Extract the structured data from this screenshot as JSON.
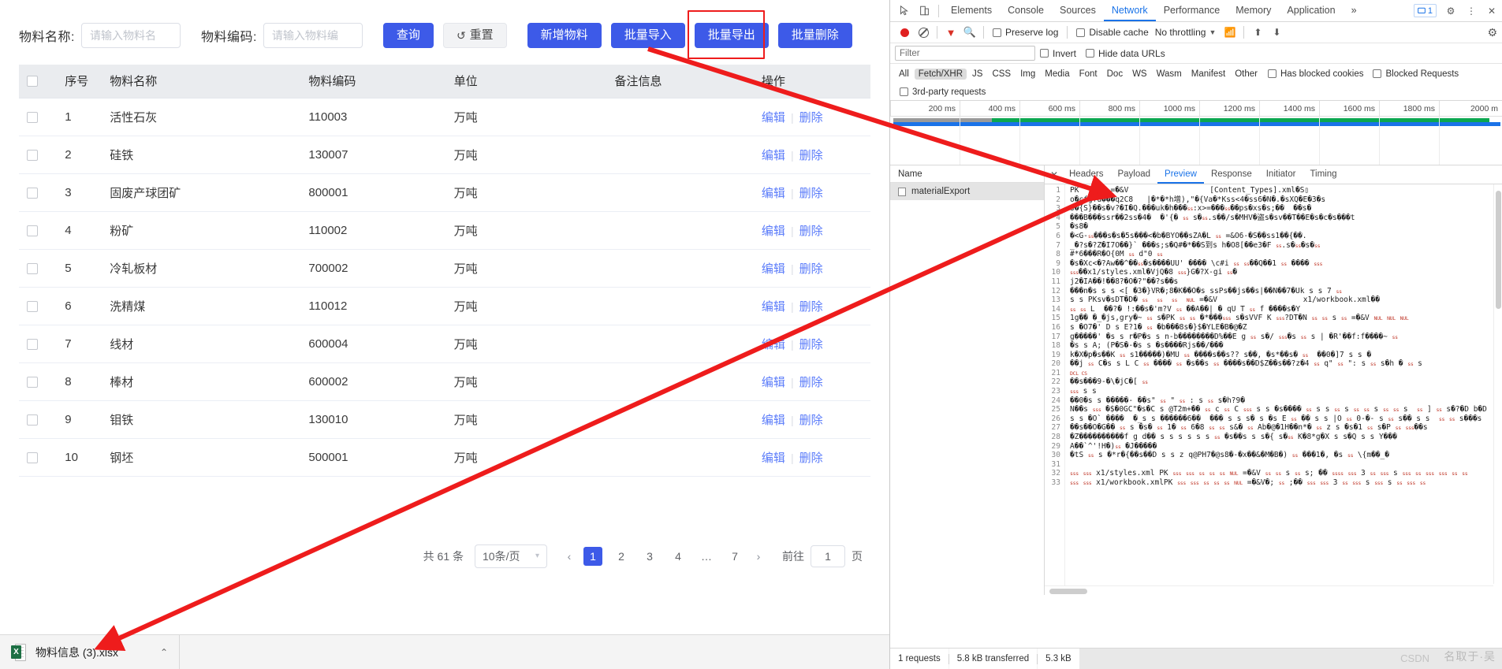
{
  "app": {
    "filters": [
      {
        "label": "物料名称:",
        "placeholder": "请输入物料名",
        "value": ""
      },
      {
        "label": "物料编码:",
        "placeholder": "请输入物料编",
        "value": ""
      }
    ],
    "buttons": {
      "query": "查询",
      "reset": "重置",
      "add": "新增物料",
      "import": "批量导入",
      "export": "批量导出",
      "delete": "批量删除"
    },
    "highlight_color": "#ee1c1c",
    "accent_color": "#3d5ae8",
    "table": {
      "columns": [
        "",
        "序号",
        "物料名称",
        "物料编码",
        "单位",
        "备注信息",
        "操作"
      ],
      "rows": [
        {
          "idx": "1",
          "name": "活性石灰",
          "code": "110003",
          "unit": "万吨",
          "memo": "",
          "edit": "编辑",
          "del": "删除"
        },
        {
          "idx": "2",
          "name": "硅铁",
          "code": "130007",
          "unit": "万吨",
          "memo": "",
          "edit": "编辑",
          "del": "删除"
        },
        {
          "idx": "3",
          "name": "固废产球团矿",
          "code": "800001",
          "unit": "万吨",
          "memo": "",
          "edit": "编辑",
          "del": "删除"
        },
        {
          "idx": "4",
          "name": "粉矿",
          "code": "110002",
          "unit": "万吨",
          "memo": "",
          "edit": "编辑",
          "del": "删除"
        },
        {
          "idx": "5",
          "name": "冷轧板材",
          "code": "700002",
          "unit": "万吨",
          "memo": "",
          "edit": "编辑",
          "del": "删除"
        },
        {
          "idx": "6",
          "name": "洗精煤",
          "code": "110012",
          "unit": "万吨",
          "memo": "",
          "edit": "编辑",
          "del": "删除"
        },
        {
          "idx": "7",
          "name": "线材",
          "code": "600004",
          "unit": "万吨",
          "memo": "",
          "edit": "编辑",
          "del": "删除"
        },
        {
          "idx": "8",
          "name": "棒材",
          "code": "600002",
          "unit": "万吨",
          "memo": "",
          "edit": "编辑",
          "del": "删除"
        },
        {
          "idx": "9",
          "name": "钼铁",
          "code": "130010",
          "unit": "万吨",
          "memo": "",
          "edit": "编辑",
          "del": "删除"
        },
        {
          "idx": "10",
          "name": "钢坯",
          "code": "500001",
          "unit": "万吨",
          "memo": "",
          "edit": "编辑",
          "del": "删除"
        }
      ]
    },
    "pagination": {
      "total_text": "共 61 条",
      "page_size": "10条/页",
      "prev": "‹",
      "next": "›",
      "pages": [
        "1",
        "2",
        "3",
        "4",
        "…",
        "7"
      ],
      "current_page": "1",
      "goto_label": "前往",
      "goto_value": "1",
      "goto_unit": "页"
    }
  },
  "download_bar": {
    "file_name": "物料信息 (3).xlsx",
    "caret": "⌃"
  },
  "devtools": {
    "tabs": [
      "Elements",
      "Console",
      "Sources",
      "Network",
      "Performance",
      "Memory",
      "Application"
    ],
    "selected_tab": "Network",
    "overflow": "»",
    "message_count": "1",
    "toolbar": {
      "preserve_log": "Preserve log",
      "disable_cache": "Disable cache",
      "throttling": "No throttling"
    },
    "filter_bar": {
      "placeholder": "Filter",
      "invert": "Invert",
      "hide_data_urls": "Hide data URLs"
    },
    "types": [
      "All",
      "Fetch/XHR",
      "JS",
      "CSS",
      "Img",
      "Media",
      "Font",
      "Doc",
      "WS",
      "Wasm",
      "Manifest",
      "Other"
    ],
    "selected_type": "Fetch/XHR",
    "has_blocked_cookies": "Has blocked cookies",
    "blocked_requests": "Blocked Requests",
    "third_party": "3rd-party requests",
    "timeline_ticks": [
      "200 ms",
      "400 ms",
      "600 ms",
      "800 ms",
      "1000 ms",
      "1200 ms",
      "1400 ms",
      "1600 ms",
      "1800 ms",
      "2000 m"
    ],
    "request_list": {
      "header": "Name",
      "items": [
        "materialExport"
      ]
    },
    "detail_tabs": [
      "Headers",
      "Payload",
      "Preview",
      "Response",
      "Initiator",
      "Timing"
    ],
    "selected_detail_tab": "Preview",
    "preview_lines": [
      "PK       =�&V                  [Content_Types].xml�S▯",
      "o�cfgfu���q2C8   |�*�*h增),\"�{Va�*Kss<4�ss6�N�.�sXQ�E�3�s",
      "s�{S}��s�v?�I�Q.���uk�h���ss:x>=���ss��ps�xs�s;��  ��s�",
      "���B���ssr��2ss�4�  �'{� ss s�ss.s��/s�MHV�盗s�sv��T��E�s�c�s���t",
      "�s8�",
      "�<G-ss���s�s�5s���<�b�BYO��sZA�L ss =&O6-�S��ss1��{��.",
      "_�?s�?Z�I7O��}` ���s;s�Q#�*��S到s h�O8[��e3�F ss.s�ss�s�ss",
      "#*6���R�O{0M ss d\"0 ss",
      "�s�Xc<�?Aw��^��ss�s����UU' ���� \\c#i ss ss��Q��1 ss ���� sss",
      "sss��x1/styles.xml�VjQ�8 sss}G�?X-gi ss�",
      "j2�IA��!��8?�O�?\"��?s��s",
      "���n�s s s <[ �3�}VR�;8�K��O�s ssPs��js��s|��N��7�Uk s s 7 ss",
      "s s PKsv�sDT�D� ss  ss  ss  NUL =�&V                   x1/workbook.xml��",
      "ss ss L  ��?� !:��s�'m?V ss ��A��| � qU T ss f ����s�Y",
      "1g�� �_�js,gry�~ ss s�PK ss ss �*���sss s�sVVF K sss?DT�N ss ss s ss =�&V NUL NUL NUL",
      "s �O7�' D s E?1� ss �b���8s�}$�YLE�B�@�Z  ",
      "g�����' �s s r�P�s s n-b��������D%��E g ss s�/ sss�s ss s | �R'��f:f����~ ss",
      "�s s A; (P�S�-�s s �s����Rjs��/���                    ",
      "k�X�p�s��K ss s1�����)�MU ss ����s��s?? s��, �s*��s� ss  ��0�]7 s s �",
      "��j ss C�s s L C ss ���� ss �s��s ss ����s��D$Z��s��?z�4 ss q\" ss \": s ss s�h � ss s",
      "DCL CS",
      "��s���9-�\\�jC�[ ss",
      "sss s s",
      "��0�s s �����- ��s\" ss \" ss : s ss s�h?9�",
      "N��s sss �$�0GC\"�s�C s @T2m+�� ss c ss C sss s s �s���� ss s s ss s ss ss s ss ss s  ss ] ss s�?�D b�D",
      "s s �O` ����  �_s s ������6��  ��� s s s� s �s E ss �� s s |O ss 0-�- s ss s�� s s  ss ss s���s",
      "��s��O�G�� ss s �s� ss 1� ss 6�8 ss ss s&� ss Ab�@�1H��n*� ss z s �s�1 ss s�P ss sss��s",
      "�Z����������f g d�� s s s s s s ss �s��s s s�{ s�ss K�8*g�X s s�Q s s Y���",
      "A��`^'!H�)ss �J�����",
      "�tS ss s �*r�{��s��D s s z q@PH7�@s8�-�x��&�M�B�) ss ���1�, �s ss \\{m��_�",
      "",
      "sss sss x1/styles.xml PK sss sss ss ss ss NUL =�&V ss ss s ss s; �� ssss sss 3 ss sss s sss ss sss sss ss ss",
      "sss sss x1/workbook.xmlPK sss sss ss ss ss NUL =�&V�; ss ;�� sss sss 3 ss sss s sss s ss sss ss"
    ],
    "status": {
      "requests": "1 requests",
      "transferred": "5.8 kB transferred",
      "resources": "5.3 kB"
    }
  },
  "watermark": {
    "text": "名取于·吴",
    "text2": "CSDN"
  }
}
